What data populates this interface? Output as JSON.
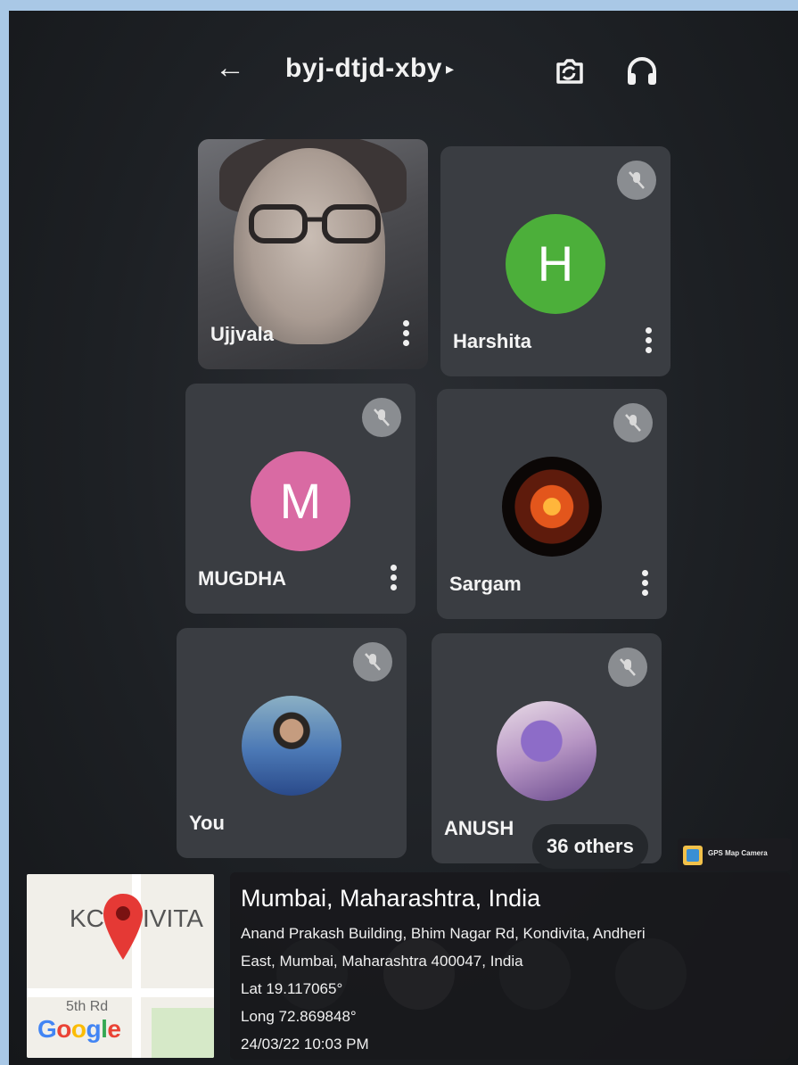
{
  "header": {
    "meeting_code": "byj-dtjd-xby",
    "back_icon": "arrow-left-icon",
    "switch_camera_icon": "switch-camera-icon",
    "audio_icon": "headphones-icon"
  },
  "participants": [
    {
      "name": "Ujjvala",
      "type": "video"
    },
    {
      "name": "Harshita",
      "initial": "H",
      "color": "#4caf3a",
      "muted": true
    },
    {
      "name": "MUGDHA",
      "initial": "M",
      "color": "#d96aa3",
      "muted": true
    },
    {
      "name": "Sargam",
      "type": "photo",
      "muted": true
    },
    {
      "name": "You",
      "type": "photo",
      "muted": true
    },
    {
      "name": "ANUSH",
      "type": "photo",
      "muted": true
    }
  ],
  "others_chip": "36 others",
  "gps": {
    "badge": "GPS Map Camera",
    "map_label_left": "KC",
    "map_label_right": "IVITA",
    "road_label": "5th Rd",
    "google_logo": "Google",
    "city": "Mumbai, Maharashtra, India",
    "address_line1": "Anand Prakash Building, Bhim Nagar Rd, Kondivita, Andheri",
    "address_line2": "East, Mumbai, Maharashtra 400047, India",
    "lat": "Lat 19.117065°",
    "long": "Long 72.869848°",
    "datetime": "24/03/22 10:03 PM"
  }
}
